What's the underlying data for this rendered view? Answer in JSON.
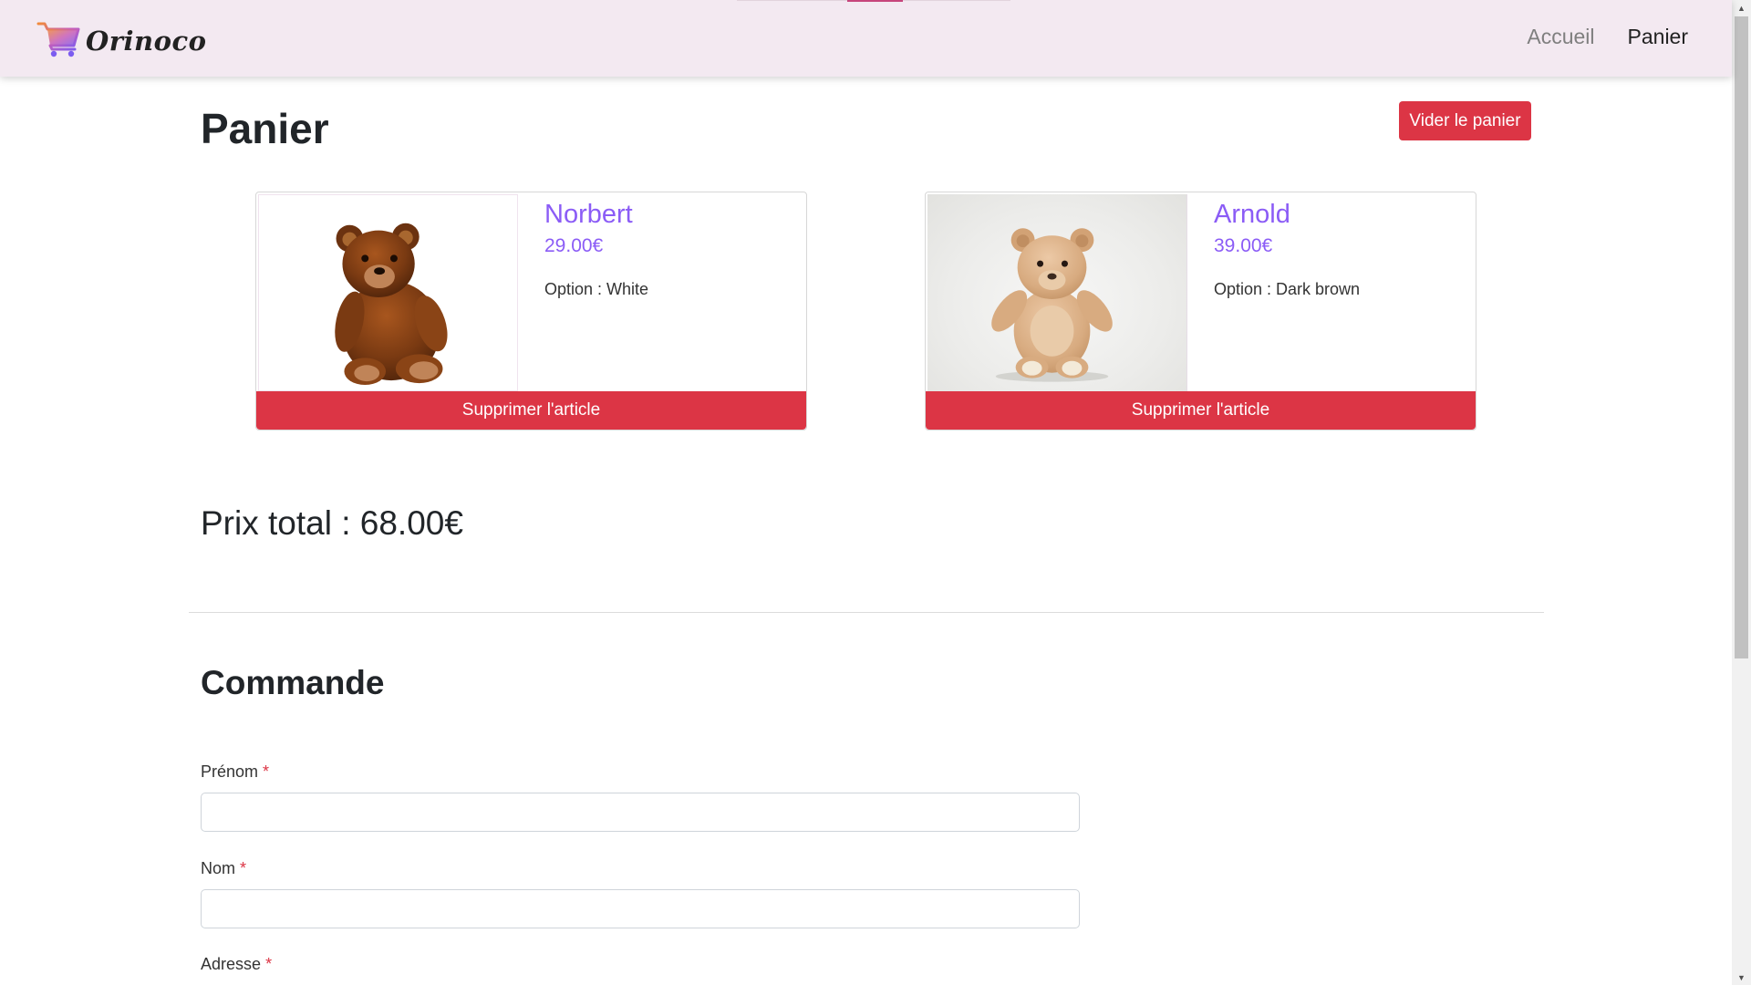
{
  "navbar": {
    "brand": "Orinoco",
    "links": [
      {
        "label": "Accueil",
        "active": false
      },
      {
        "label": "Panier",
        "active": true
      }
    ]
  },
  "page": {
    "title": "Panier",
    "empty_button": "Vider le panier"
  },
  "cart": {
    "items": [
      {
        "name": "Norbert",
        "price": "29.00€",
        "option": "Option : White",
        "remove_label": "Supprimer l'article",
        "image": "teddy-bear-brown"
      },
      {
        "name": "Arnold",
        "price": "39.00€",
        "option": "Option : Dark brown",
        "remove_label": "Supprimer l'article",
        "image": "teddy-bear-beige"
      }
    ],
    "total": "Prix total : 68.00€"
  },
  "order": {
    "title": "Commande",
    "fields": [
      {
        "label": "Prénom",
        "required_mark": "*",
        "value": ""
      },
      {
        "label": "Nom",
        "required_mark": "*",
        "value": ""
      },
      {
        "label": "Adresse",
        "required_mark": "*",
        "value": ""
      }
    ]
  },
  "colors": {
    "navbar_bg": "#f3e9f1",
    "accent_purple": "#8b5cf6",
    "danger": "#dc3545"
  }
}
